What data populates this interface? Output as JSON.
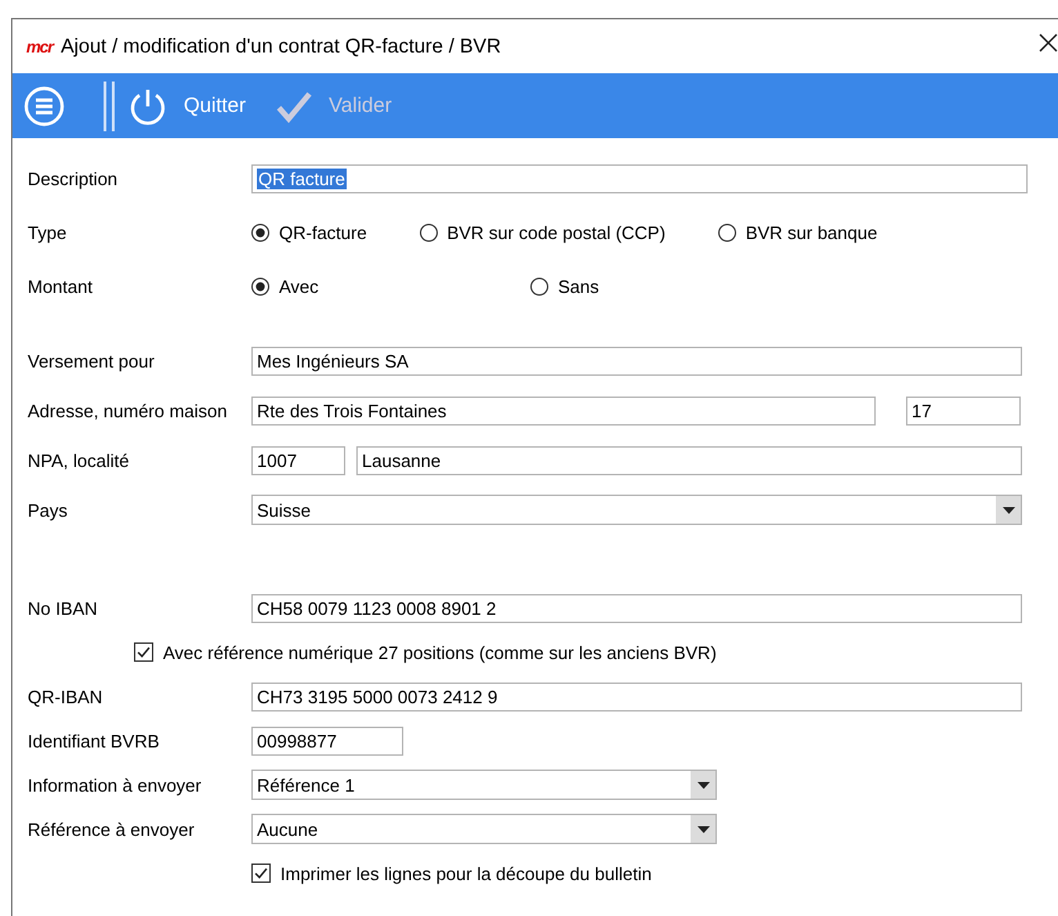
{
  "window": {
    "logo": "mcr",
    "title": "Ajout / modification d'un contrat QR-facture / BVR"
  },
  "toolbar": [
    {
      "kind": "menu"
    },
    {
      "kind": "power",
      "label": "Quitter",
      "disabled": false
    },
    {
      "kind": "check",
      "label": "Valider",
      "disabled": true
    }
  ],
  "sections": [
    {
      "rows": [
        {
          "kind": "text",
          "label": "Description",
          "fields": [
            {
              "value": "QR facture",
              "highlighted": true
            }
          ]
        },
        {
          "kind": "radio",
          "label": "Type",
          "options": [
            {
              "label": "QR-facture",
              "selected": true
            },
            {
              "label": "BVR sur code postal (CCP)",
              "selected": false
            },
            {
              "label": "BVR sur banque",
              "selected": false
            }
          ]
        },
        {
          "kind": "radio",
          "label": "Montant",
          "options": [
            {
              "label": "Avec",
              "selected": true
            },
            {
              "label": "Sans",
              "selected": false
            }
          ]
        }
      ]
    },
    {
      "rows": [
        {
          "kind": "text",
          "label": "Versement pour",
          "fields": [
            {
              "value": "Mes Ingénieurs SA",
              "highlighted": false
            }
          ]
        },
        {
          "kind": "address",
          "label": "Adresse, numéro maison",
          "fields": [
            {
              "value": "Rte des Trois Fontaines",
              "highlighted": false
            },
            {
              "value": "17",
              "highlighted": false
            }
          ]
        },
        {
          "kind": "npa",
          "label": "NPA, localité",
          "fields": [
            {
              "value": "1007",
              "highlighted": false
            },
            {
              "value": "Lausanne",
              "highlighted": false
            }
          ]
        },
        {
          "kind": "select",
          "label": "Pays",
          "value": "Suisse"
        }
      ]
    },
    {
      "rows": [
        {
          "kind": "text",
          "label": "No IBAN",
          "fields": [
            {
              "value": "CH58 0079 1123 0008 8901 2",
              "highlighted": false
            }
          ]
        },
        {
          "kind": "checkbox",
          "label": "Avec référence numérique 27 positions (comme sur les anciens BVR)",
          "checked": true
        },
        {
          "kind": "text",
          "label": "QR-IBAN",
          "fields": [
            {
              "value": "CH73 3195 5000 0073 2412 9",
              "highlighted": false
            }
          ]
        },
        {
          "kind": "short",
          "label": "Identifiant BVRB",
          "fields": [
            {
              "value": "00998877",
              "highlighted": false
            }
          ]
        },
        {
          "kind": "halfselect",
          "label": "Information à envoyer",
          "value": "Référence 1"
        },
        {
          "kind": "halfselect",
          "label": "Référence à envoyer",
          "value": "Aucune"
        },
        {
          "kind": "checkbox2",
          "label": "Imprimer les lignes pour la découpe du bulletin",
          "checked": true
        }
      ]
    }
  ]
}
